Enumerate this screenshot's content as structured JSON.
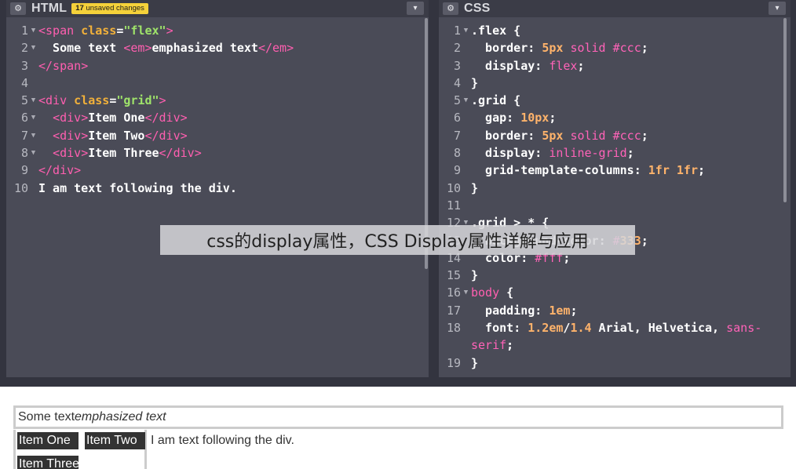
{
  "html_pane": {
    "gear_icon": "gear-icon",
    "title": "HTML",
    "badge_count": "17",
    "badge_text": "unsaved changes",
    "collapse_icon": "chevron-down-icon",
    "line_numbers": [
      "1",
      "2",
      "3",
      "4",
      "5",
      "6",
      "7",
      "8",
      "9",
      "10"
    ],
    "lines": [
      "<span class=\"flex\">",
      "  Some text <em>emphasized text</em>",
      "</span>",
      "",
      "<div class=\"grid\">",
      "  <div>Item One</div>",
      "  <div>Item Two</div>",
      "  <div>Item Three</div>",
      "</div>",
      "I am text following the div."
    ]
  },
  "css_pane": {
    "gear_icon": "gear-icon",
    "title": "CSS",
    "collapse_icon": "chevron-down-icon",
    "line_numbers": [
      "1",
      "2",
      "3",
      "4",
      "5",
      "6",
      "7",
      "8",
      "9",
      "10",
      "11",
      "12",
      "13",
      "14",
      "15",
      "16",
      "17",
      "18",
      "",
      "19"
    ],
    "lines": [
      ".flex {",
      "  border: 5px solid #ccc;",
      "  display: flex;",
      "}",
      ".grid {",
      "  gap: 10px;",
      "  border: 5px solid #ccc;",
      "  display: inline-grid;",
      "  grid-template-columns: 1fr 1fr;",
      "}",
      "",
      ".grid > * {",
      "  background-color: #333;",
      "  color: #fff;",
      "}",
      "body {",
      "  padding: 1em;",
      "  font: 1.2em/1.4 Arial, Helvetica, sans-",
      "serif;",
      "}"
    ]
  },
  "output": {
    "flex_text": "Some text",
    "flex_em": "emphasized text",
    "grid_items": [
      "Item One",
      "Item Two",
      "Item Three"
    ],
    "after_text": "I am text following the div."
  },
  "banner": {
    "text": "css的display属性，CSS Display属性详解与应用"
  },
  "colors": {
    "editor_bg": "#4a4b57",
    "tag": "#ff5fb0",
    "attr": "#f1b03a",
    "string": "#9fe36a",
    "number": "#ffb36b",
    "badge": "#f5d13a"
  }
}
